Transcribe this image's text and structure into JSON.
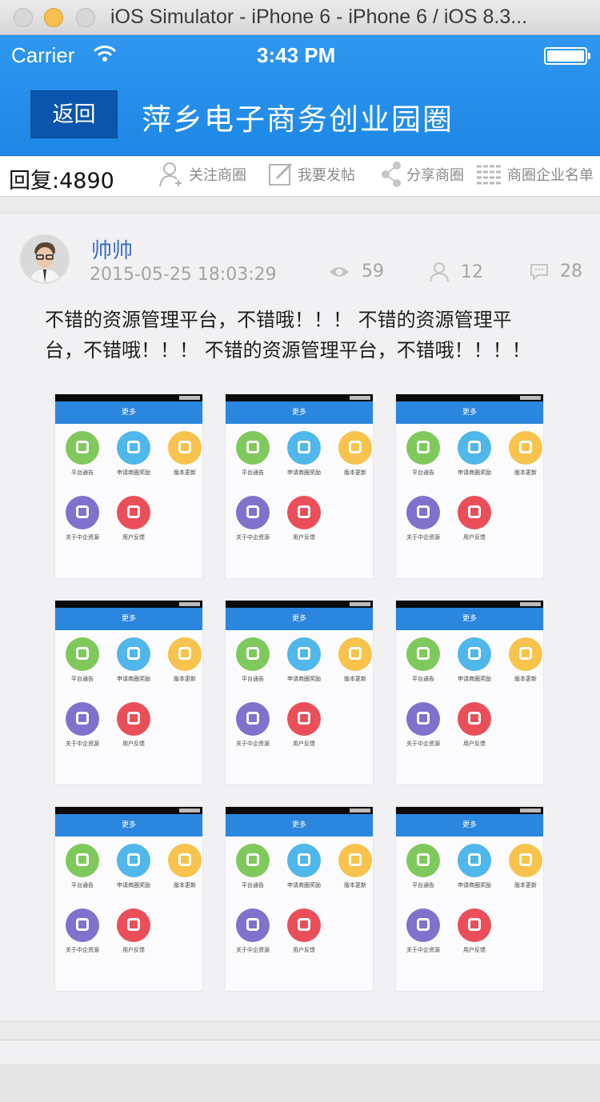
{
  "window": {
    "title": "iOS Simulator - iPhone 6 - iPhone 6 / iOS 8.3..."
  },
  "status_bar": {
    "carrier": "Carrier",
    "time": "3:43 PM"
  },
  "nav": {
    "back_label": "返回",
    "title": "萍乡电子商务创业园圈"
  },
  "action_bar": {
    "reply_count": "回复:4890",
    "actions": [
      "关注商圈",
      "我要发帖",
      "分享商圈",
      "商圈企业名单"
    ]
  },
  "post": {
    "username": "帅帅",
    "date": "2015-05-25  18:03:29",
    "views": "59",
    "likes": "12",
    "comments": "28",
    "body": "不错的资源管理平台，不错哦！！！ 不错的资源管理平台，不错哦！！！ 不错的资源管理平台，不错哦！！！！",
    "thumbnail": {
      "header": "更多",
      "items": [
        "平台通告",
        "申请商圈奖励",
        "版本更新",
        "关于中企资源",
        "用户反馈"
      ]
    }
  },
  "colors": {
    "header_blue": "#2f97ee",
    "back_button": "#0c55ad",
    "username": "#3e6ec7"
  }
}
